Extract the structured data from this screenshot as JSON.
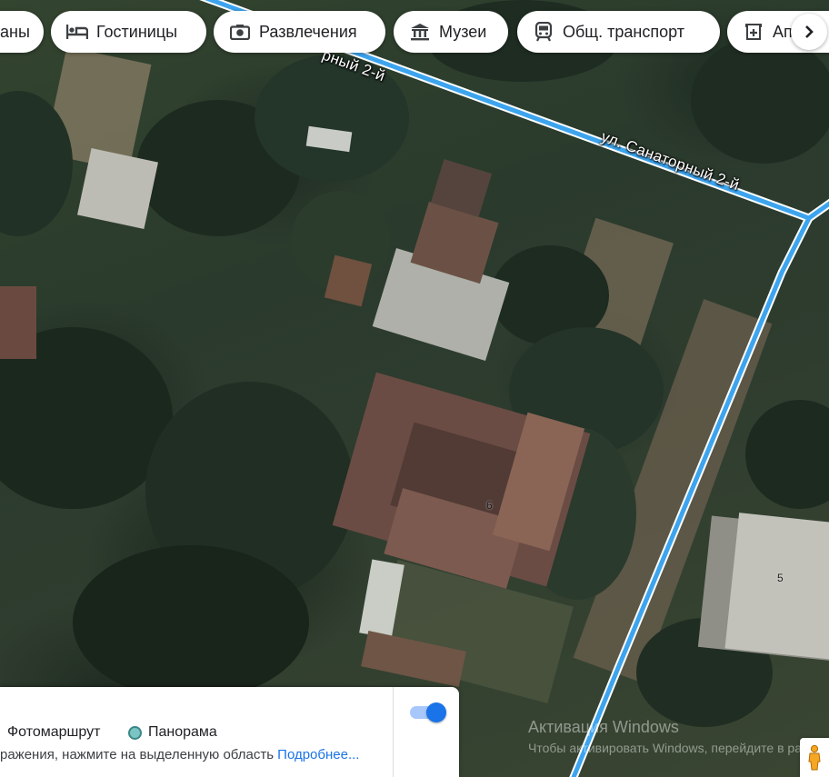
{
  "chips": [
    {
      "label": "аны",
      "icon": "none"
    },
    {
      "label": "Гостиницы",
      "icon": "bed-icon"
    },
    {
      "label": "Развлечения",
      "icon": "camera-icon"
    },
    {
      "label": "Музеи",
      "icon": "museum-icon"
    },
    {
      "label": "Общ. транспорт",
      "icon": "transit-icon"
    },
    {
      "label": "Ап",
      "icon": "pharmacy-icon"
    }
  ],
  "map": {
    "street_label_1": "рный 2-й",
    "street_label_2": "ул. Санаторный 2-й",
    "house_numbers": [
      "6",
      "5"
    ],
    "road_color": "#3da4ee"
  },
  "layers_panel": {
    "option_photo": "Фотомаршрут",
    "option_panorama": "Панорама",
    "hint_text": "ражения, нажмите на выделенную область ",
    "hint_link": "Подробнее...",
    "toggle_on": true
  },
  "watermark": {
    "title": "Активация Windows",
    "subtitle": "Чтобы активировать Windows, перейдите в раз"
  }
}
